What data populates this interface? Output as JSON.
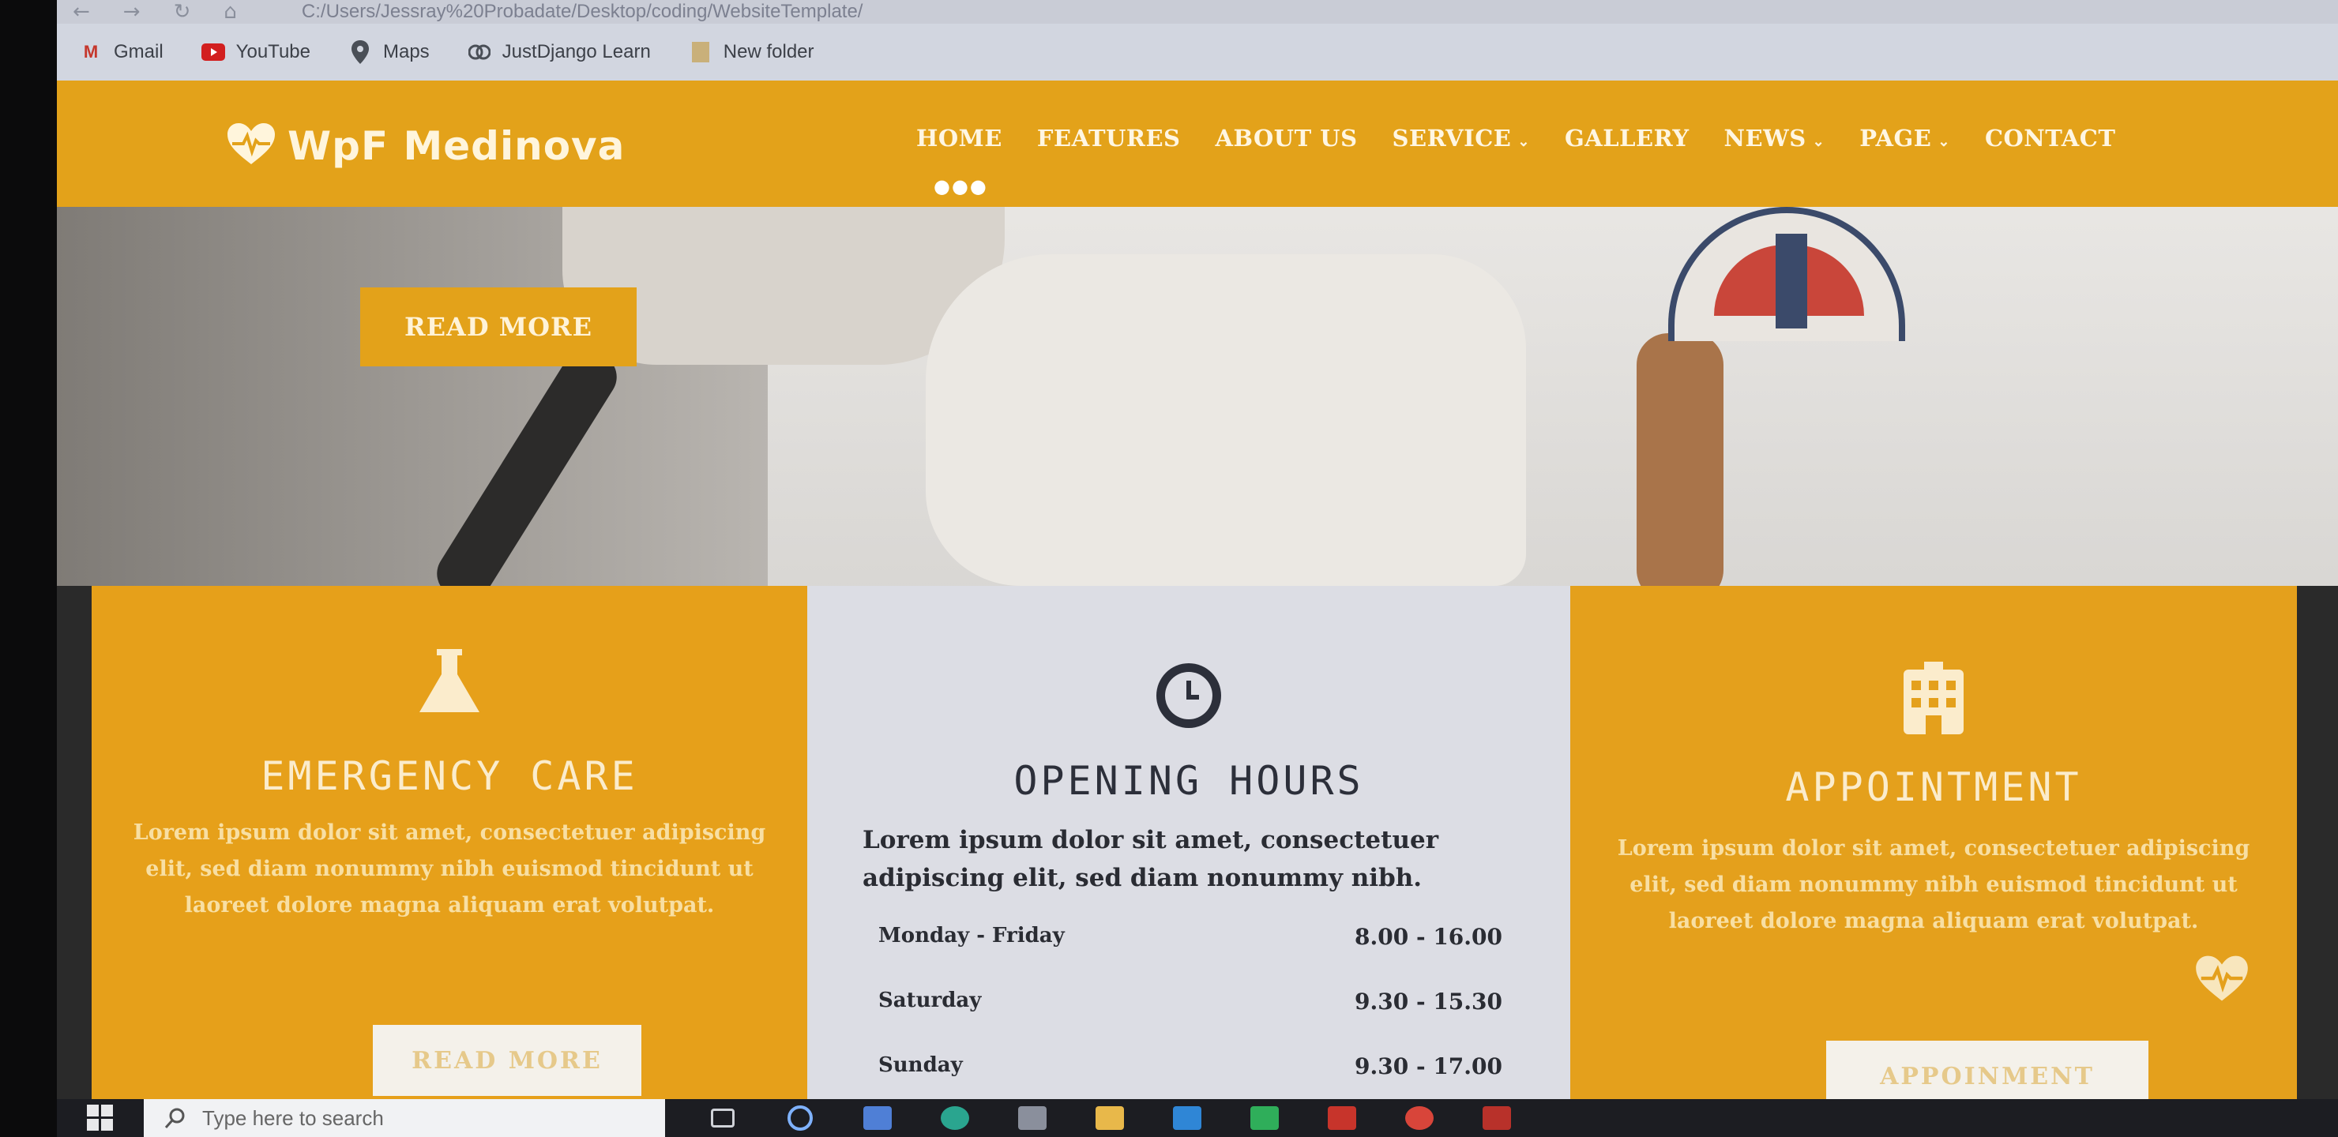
{
  "browser": {
    "url": "C:/Users/Jessray%20Probadate/Desktop/coding/WebsiteTemplate/",
    "bookmarks": [
      {
        "label": "Gmail",
        "icon": "gmail-icon",
        "color": "#c5372c"
      },
      {
        "label": "YouTube",
        "icon": "youtube-icon",
        "color": "#d21f1f"
      },
      {
        "label": "Maps",
        "icon": "map-pin-icon",
        "color": "#4a4f57"
      },
      {
        "label": "JustDjango Learn",
        "icon": "justdjango-icon",
        "color": "#4a4f57"
      },
      {
        "label": "New folder",
        "icon": "folder-icon",
        "color": "#c9b07a"
      }
    ]
  },
  "site": {
    "logo_text": "WpF Medinova",
    "nav": [
      {
        "label": "HOME",
        "has_dropdown": false,
        "active": true
      },
      {
        "label": "FEATURES",
        "has_dropdown": false
      },
      {
        "label": "ABOUT US",
        "has_dropdown": false
      },
      {
        "label": "SERVICE",
        "has_dropdown": true
      },
      {
        "label": "GALLERY",
        "has_dropdown": false
      },
      {
        "label": "NEWS",
        "has_dropdown": true
      },
      {
        "label": "PAGE",
        "has_dropdown": true
      },
      {
        "label": "CONTACT",
        "has_dropdown": false
      }
    ],
    "hero_button": "READ MORE",
    "accent": "#e3a21a"
  },
  "cards": {
    "emergency": {
      "icon": "flask-icon",
      "title": "EMERGENCY CARE",
      "body": "Lorem ipsum dolor sit amet, consectetuer adipiscing elit, sed diam nonummy nibh euismod tincidunt ut laoreet dolore magna aliquam erat volutpat.",
      "button": "READ MORE"
    },
    "hours": {
      "icon": "clock-icon",
      "title": "OPENING HOURS",
      "body": "Lorem ipsum dolor sit amet, consectetuer adipiscing elit, sed diam nonummy nibh.",
      "rows": [
        {
          "day": "Monday - Friday",
          "time": "8.00 - 16.00"
        },
        {
          "day": "Saturday",
          "time": "9.30 - 15.30"
        },
        {
          "day": "Sunday",
          "time": "9.30 - 17.00"
        }
      ]
    },
    "appointment": {
      "icon": "hospital-icon",
      "title": "APPOINTMENT",
      "body": "Lorem ipsum dolor sit amet, consectetuer adipiscing elit, sed diam nonummy nibh euismod tincidunt ut laoreet dolore magna aliquam erat volutpat.",
      "button": "APPOINMENT"
    }
  },
  "taskbar": {
    "search_placeholder": "Type here to search"
  }
}
